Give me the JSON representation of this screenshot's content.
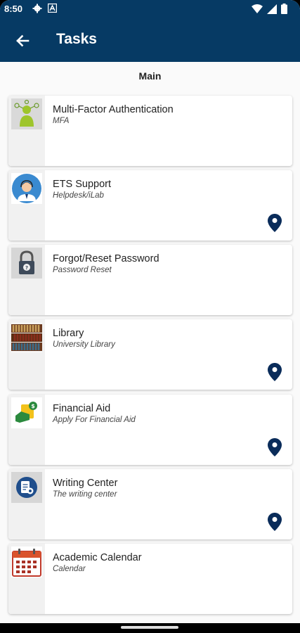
{
  "status_bar": {
    "time": "8:50",
    "icons_left": [
      "gear-icon",
      "a-icon"
    ],
    "icons_right": [
      "wifi-icon",
      "signal-icon",
      "battery-icon"
    ]
  },
  "header": {
    "title": "Tasks",
    "back_icon": "arrow-left-icon",
    "color": "#063a64"
  },
  "section": {
    "label": "Main"
  },
  "tasks": [
    {
      "title": "Multi-Factor Authentication",
      "subtitle": "MFA",
      "icon": "mfa-thumbnail",
      "has_location": false
    },
    {
      "title": "ETS Support",
      "subtitle": "Helpdesk/iLab",
      "icon": "support-agent-thumbnail",
      "has_location": true
    },
    {
      "title": "Forgot/Reset Password",
      "subtitle": "Password Reset",
      "icon": "padlock-thumbnail",
      "has_location": false
    },
    {
      "title": "Library",
      "subtitle": "University Library",
      "icon": "bookshelf-thumbnail",
      "has_location": true
    },
    {
      "title": "Financial Aid",
      "subtitle": "Apply For Financial Aid",
      "icon": "financial-aid-thumbnail",
      "has_location": true
    },
    {
      "title": "Writing Center",
      "subtitle": "The writing center",
      "icon": "writing-center-thumbnail",
      "has_location": true
    },
    {
      "title": "Academic Calendar",
      "subtitle": "Calendar",
      "icon": "calendar-thumbnail",
      "has_location": false
    }
  ],
  "colors": {
    "accent": "#063a64",
    "pin": "#0a2c5a"
  }
}
